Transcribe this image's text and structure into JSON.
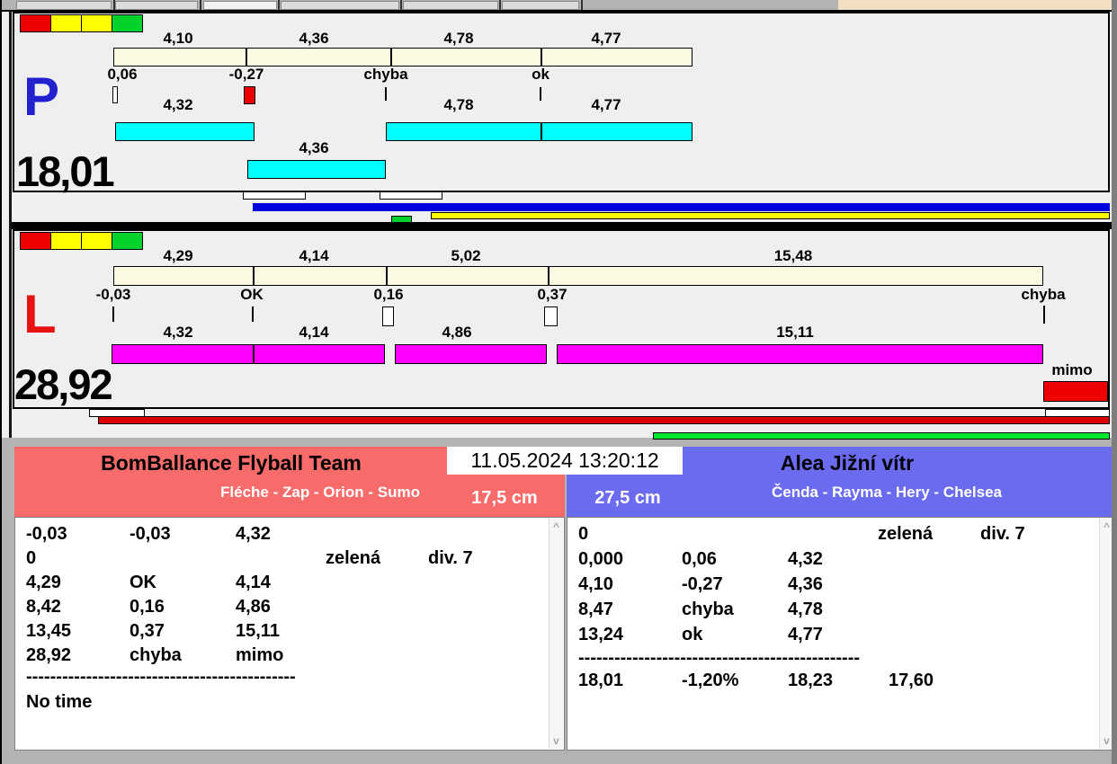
{
  "timestamp": "11.05.2024 13:20:12",
  "icons": {
    "scroll_up": "^",
    "scroll_down": "v"
  },
  "colors": {
    "lane_p_letter": "#2121CE",
    "lane_l_letter": "#E91212",
    "cream_bar": "#FBFAE1",
    "cyan_bar": "#00FFFF",
    "magenta_bar": "#FF00FF",
    "red": "#EE0000",
    "yellow": "#FFFF00",
    "green": "#00D22B",
    "blue_bar": "#0000DE",
    "team_left_header": "#F86B6B",
    "team_right_header": "#6B6BF0",
    "tan_strip": "#F2DEC1",
    "chrome_gray": "#B3B3B3"
  },
  "lane_p": {
    "letter": "P",
    "total": "18,01",
    "squares": [
      "#EE0000",
      "#FFFF00",
      "#FFFF00",
      "#00D22B"
    ],
    "splits": [
      "4,10",
      "4,36",
      "4,78",
      "4,77"
    ],
    "marks": [
      {
        "label": "0,06",
        "marker": "white-box"
      },
      {
        "label": "-0,27",
        "marker": "red-box"
      },
      {
        "label": "chyba",
        "marker": "tick"
      },
      {
        "label": "ok",
        "marker": "tick"
      }
    ],
    "dog_times": [
      "4,32",
      "4,78",
      "4,77"
    ],
    "dog_time_row2": "4,36"
  },
  "lane_l": {
    "letter": "L",
    "total": "28,92",
    "squares": [
      "#EE0000",
      "#FFFF00",
      "#FFFF00",
      "#00D22B"
    ],
    "splits": [
      "4,29",
      "4,14",
      "5,02",
      "15,48"
    ],
    "marks": [
      {
        "label": "-0,03",
        "marker": "tick"
      },
      {
        "label": "OK",
        "marker": "tick"
      },
      {
        "label": "0,16",
        "marker": "white-box"
      },
      {
        "label": "0,37",
        "marker": "white-box"
      },
      {
        "label": "chyba",
        "marker": "tick"
      }
    ],
    "dog_times": [
      "4,32",
      "4,14",
      "4,86",
      "15,11"
    ],
    "overflow_label": "mimo"
  },
  "teams": {
    "left": {
      "name": "BomBallance Flyball Team",
      "dogs": "Fléche - Zap - Orion - Sumo",
      "jump_height": "17,5 cm",
      "rows": [
        {
          "c1": "-0,03",
          "c2": "-0,03",
          "c3": "4,32"
        },
        {
          "c1": "0",
          "c4": "zelená",
          "c5": "div. 7"
        },
        {
          "c1": "4,29",
          "c2": "OK",
          "c3": "4,14"
        },
        {
          "c1": "8,42",
          "c2": "0,16",
          "c3": "4,86"
        },
        {
          "c1": "13,45",
          "c2": "0,37",
          "c3": "15,11"
        },
        {
          "c1": "28,92",
          "c2": "chyba",
          "c3": "mimo"
        }
      ],
      "divider": "---------------------------------------------",
      "footer": "No time"
    },
    "right": {
      "name": "Alea Jižní vítr",
      "dogs": "Čenda - Rayma - Hery - Chelsea",
      "jump_height": "27,5 cm",
      "rows": [
        {
          "c1": "0",
          "c4": "zelená",
          "c5": "div. 7"
        },
        {
          "c1": "0,000",
          "c2": "0,06",
          "c3": "4,32"
        },
        {
          "c1": "4,10",
          "c2": "-0,27",
          "c3": "4,36"
        },
        {
          "c1": "8,47",
          "c2": "chyba",
          "c3": "4,78"
        },
        {
          "c1": "13,24",
          "c2": "ok",
          "c3": "4,77"
        }
      ],
      "divider": "-----------------------------------------------",
      "totals": {
        "c1": "18,01",
        "c2": "-1,20%",
        "c3": "18,23",
        "c4": "17,60"
      }
    }
  }
}
